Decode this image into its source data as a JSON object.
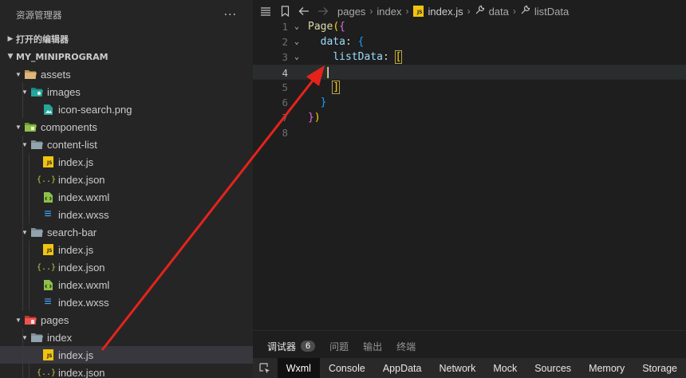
{
  "sidebar": {
    "title": "资源管理器",
    "more": "···",
    "open_editors": "打开的编辑器",
    "project": "MY_MINIPROGRAM",
    "tree": {
      "assets": "assets",
      "images": "images",
      "icon_search": "icon-search.png",
      "components": "components",
      "content_list": "content-list",
      "cl_js": "index.js",
      "cl_json": "index.json",
      "cl_wxml": "index.wxml",
      "cl_wxss": "index.wxss",
      "search_bar": "search-bar",
      "sb_js": "index.js",
      "sb_json": "index.json",
      "sb_wxml": "index.wxml",
      "sb_wxss": "index.wxss",
      "pages": "pages",
      "index": "index",
      "idx_js": "index.js",
      "idx_json": "index.json"
    },
    "icon_glyphs": {
      "js": "JS",
      "json": "{..}",
      "wxss": "≡"
    }
  },
  "editor": {
    "breadcrumb": {
      "pages": "pages",
      "index": "index",
      "file": "index.js",
      "data": "data",
      "listData": "listData",
      "js_icon": "JS"
    },
    "line_numbers": [
      "1",
      "2",
      "3",
      "4",
      "5",
      "6",
      "7",
      "8"
    ],
    "code": {
      "l1_fn": "Page",
      "l1_paren": "(",
      "l1_brace": "{",
      "l2_prop": "data",
      "l2_colon": ": ",
      "l2_brace": "{",
      "l3_prop": "listData",
      "l3_colon": ": ",
      "l3_bracket": "[",
      "l5_bracket": "]",
      "l6_brace": "}",
      "l7_brace": "}",
      "l7_paren": ")"
    },
    "current_line": "4"
  },
  "panel": {
    "tabs": [
      "调试器",
      "问题",
      "输出",
      "终端"
    ],
    "badge": "6",
    "devtools_tabs": [
      "Wxml",
      "Console",
      "AppData",
      "Network",
      "Mock",
      "Sources",
      "Memory",
      "Storage"
    ]
  },
  "colors": {
    "sidebar_bg": "#252526",
    "editor_bg": "#1e1e1e",
    "folder_yellow": "#dcb67a",
    "js_yellow": "#f1c40f",
    "wxml_green": "#8dc149",
    "wxss_blue": "#42a5f5",
    "arrow_red": "#e5231b"
  }
}
